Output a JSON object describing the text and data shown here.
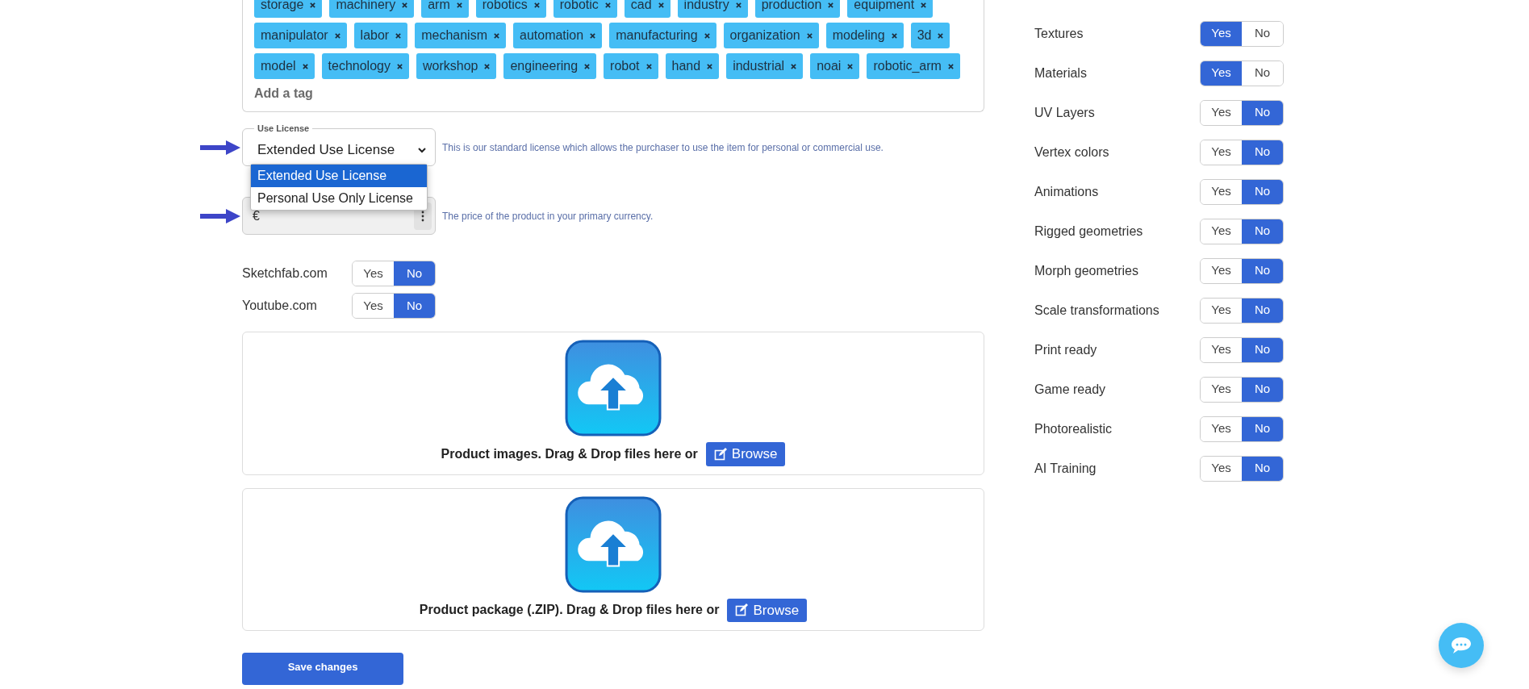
{
  "tags": [
    "storage",
    "machinery",
    "arm",
    "robotics",
    "robotic",
    "cad",
    "industry",
    "production",
    "equipment",
    "manipulator",
    "labor",
    "mechanism",
    "automation",
    "manufacturing",
    "organization",
    "modeling",
    "3d",
    "model",
    "technology",
    "workshop",
    "engineering",
    "robot",
    "hand",
    "industrial",
    "noai",
    "robotic_arm"
  ],
  "tag_input": {
    "placeholder": "Add a tag"
  },
  "license": {
    "label": "Use License",
    "value": "Extended Use License",
    "help": "This is our standard license which allows the purchaser to use the item for personal or commercial use.",
    "expanded": true,
    "options": [
      {
        "label": "Extended Use License",
        "selected": true
      },
      {
        "label": "Personal Use Only License",
        "selected": false
      }
    ]
  },
  "price": {
    "value": "€",
    "help": "The price of the product in your primary currency."
  },
  "platforms": [
    {
      "label": "Sketchfab.com",
      "yes": "Yes",
      "no": "No",
      "on": false
    },
    {
      "label": "Youtube.com",
      "yes": "Yes",
      "no": "No",
      "on": false
    }
  ],
  "uploads": [
    {
      "text": "Product images. Drag & Drop files here or",
      "button": "Browse"
    },
    {
      "text": "Product package (.ZIP). Drag & Drop files here or",
      "button": "Browse"
    }
  ],
  "save_button": "Save changes",
  "features": [
    {
      "label": "Textures",
      "yes": "Yes",
      "no": "No",
      "on": true
    },
    {
      "label": "Materials",
      "yes": "Yes",
      "no": "No",
      "on": true
    },
    {
      "label": "UV Layers",
      "yes": "Yes",
      "no": "No",
      "on": false
    },
    {
      "label": "Vertex colors",
      "yes": "Yes",
      "no": "No",
      "on": false
    },
    {
      "label": "Animations",
      "yes": "Yes",
      "no": "No",
      "on": false
    },
    {
      "label": "Rigged geometries",
      "yes": "Yes",
      "no": "No",
      "on": false
    },
    {
      "label": "Morph geometries",
      "yes": "Yes",
      "no": "No",
      "on": false
    },
    {
      "label": "Scale transformations",
      "yes": "Yes",
      "no": "No",
      "on": false
    },
    {
      "label": "Print ready",
      "yes": "Yes",
      "no": "No",
      "on": false
    },
    {
      "label": "Game ready",
      "yes": "Yes",
      "no": "No",
      "on": false
    },
    {
      "label": "Photorealistic",
      "yes": "Yes",
      "no": "No",
      "on": false
    },
    {
      "label": "AI Training",
      "yes": "Yes",
      "no": "No",
      "on": false
    }
  ]
}
